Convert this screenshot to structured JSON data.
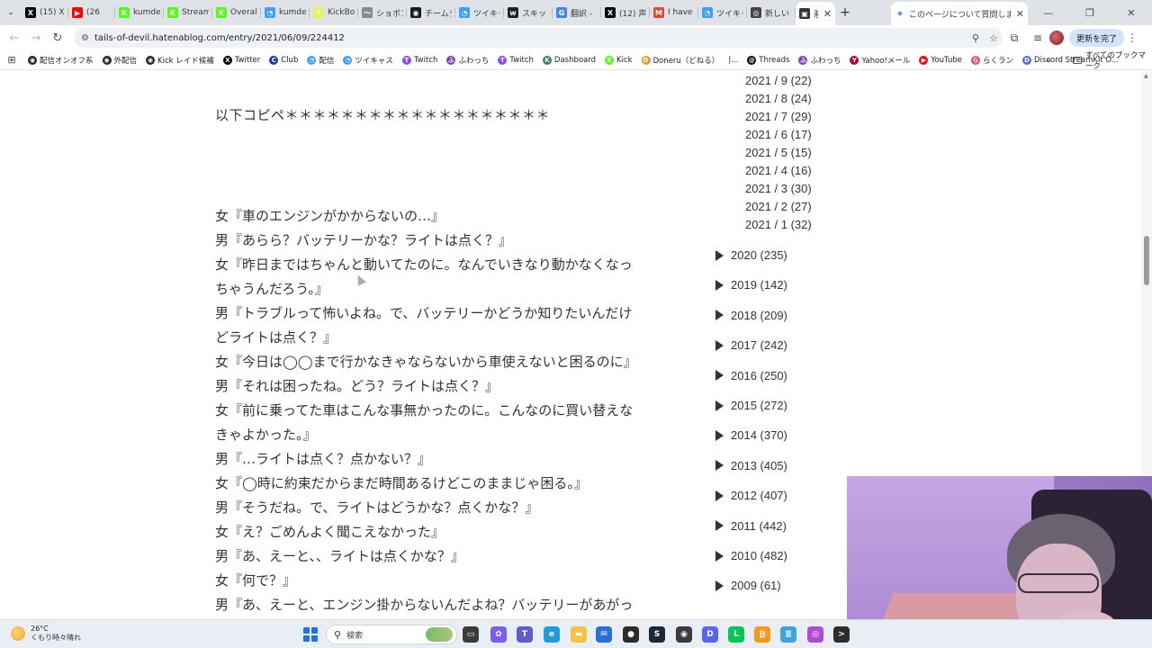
{
  "browser": {
    "tabs": [
      {
        "title": "(15) X",
        "color": "#000000",
        "glyph": "X"
      },
      {
        "title": "(26",
        "color": "#ff0000",
        "glyph": "▶"
      },
      {
        "title": "kumde",
        "color": "#53fc18",
        "glyph": "K"
      },
      {
        "title": "Stream",
        "color": "#53fc18",
        "glyph": "K"
      },
      {
        "title": "Overal",
        "color": "#53fc18",
        "glyph": "K"
      },
      {
        "title": "kumde",
        "color": "#3aa0ff",
        "glyph": "◔"
      },
      {
        "title": "KickBo",
        "color": "#e8f060",
        "glyph": "✕"
      },
      {
        "title": "ショボン",
        "color": "#8a8a8a",
        "glyph": "〜"
      },
      {
        "title": "チームデ",
        "color": "#1c1c1c",
        "glyph": "◉"
      },
      {
        "title": "ツイキャ",
        "color": "#3aa0ff",
        "glyph": "◔"
      },
      {
        "title": "スキッ",
        "color": "#222222",
        "glyph": "w"
      },
      {
        "title": "翻訳 -",
        "color": "#4285f4",
        "glyph": "G"
      },
      {
        "title": "(12) 声",
        "color": "#000000",
        "glyph": "X"
      },
      {
        "title": "I have",
        "color": "#ea4335",
        "glyph": "M"
      },
      {
        "title": "ツイキャ",
        "color": "#3aa0ff",
        "glyph": "◔"
      },
      {
        "title": "新しい",
        "color": "#444444",
        "glyph": "◎"
      },
      {
        "title": "悪",
        "color": "#333333",
        "glyph": "▣"
      }
    ],
    "gemini_tab": {
      "title": "このページについて質問しますか？",
      "glyph": "✦"
    },
    "new_tab_label": "+",
    "window_controls": {
      "minimize": "—",
      "restore": "❐",
      "close": "✕"
    },
    "nav": {
      "back": "←",
      "forward": "→",
      "reload": "↻",
      "site_info": "⚙"
    },
    "url": "tails-of-devil.hatenablog.com/entry/2021/06/09/224412",
    "omnibox_icons": {
      "zoom": "⚲",
      "bookmark": "☆"
    },
    "toolbar_icons": {
      "extensions": "⧉",
      "tab_search": "≡"
    },
    "update_button": "更新を完了",
    "menu": "⋮",
    "bookmarks": [
      {
        "label": "配信オンオフ系",
        "color": "#222222",
        "glyph": "◉"
      },
      {
        "label": "外配信",
        "color": "#222222",
        "glyph": "◉"
      },
      {
        "label": "Kick レイド候補",
        "color": "#222222",
        "glyph": "◉"
      },
      {
        "label": "Twitter",
        "color": "#000000",
        "glyph": "X"
      },
      {
        "label": "Club",
        "color": "#1a3ca8",
        "glyph": "C"
      },
      {
        "label": "配信",
        "color": "#3aa0ff",
        "glyph": "◔"
      },
      {
        "label": "ツイキャス",
        "color": "#3aa0ff",
        "glyph": "◔"
      },
      {
        "label": "Twitch",
        "color": "#9146ff",
        "glyph": "T"
      },
      {
        "label": "ふわっち",
        "color": "#7b3fbf",
        "glyph": "ふ"
      },
      {
        "label": "Twitch",
        "color": "#9146ff",
        "glyph": "T"
      },
      {
        "label": "Dashboard",
        "color": "#2a8a5a",
        "glyph": "K"
      },
      {
        "label": "Kick",
        "color": "#53fc18",
        "glyph": "K"
      },
      {
        "label": "Doneru（どねる）",
        "color": "#e39a2a",
        "glyph": "D"
      },
      {
        "label": "|...",
        "color": "#ffffff",
        "glyph": ""
      },
      {
        "label": "Threads",
        "color": "#000000",
        "glyph": "@"
      },
      {
        "label": "ふわっち",
        "color": "#7b3fbf",
        "glyph": "ふ"
      },
      {
        "label": "Yahoo!メール",
        "color": "#c0002a",
        "glyph": "Y"
      },
      {
        "label": "YouTube",
        "color": "#ff0000",
        "glyph": "▶"
      },
      {
        "label": "らくラン",
        "color": "#e04a8a",
        "glyph": "ら"
      },
      {
        "label": "Discord StreamKit O...",
        "color": "#5865f2",
        "glyph": "D"
      }
    ],
    "bookmarks_overflow": "»",
    "all_bookmarks": "すべてのブックマーク",
    "apps_icon": "⊞"
  },
  "article": {
    "heading": "以下コピペ＊＊＊＊＊＊＊＊＊＊＊＊＊＊＊＊＊＊＊",
    "lines": [
      "女『車のエンジンがかからないの…』",
      "男『あらら？バッテリーかな？ライトは点く？』",
      "女『昨日まではちゃんと動いてたのに。なんでいきなり動かなくなっ",
      "ちゃうんだろう。』",
      "男『トラブルって怖いよね。で、バッテリーかどうか知りたいんだけ",
      "どライトは点く？』",
      "女『今日は◯◯まで行かなきゃならないから車使えないと困るのに』",
      "男『それは困ったね。どう？ライトは点く？』",
      "女『前に乗ってた車はこんな事無かったのに。こんなのに買い替えな",
      "きゃよかった。』",
      "男『…ライトは点く？点かない？』",
      "女『◯時に約束だからまだ時間あるけどこのままじゃ困る。』",
      "男『そうだね。で、ライトはどうかな？点くかな？』",
      "女『え？ごめんよく聞こえなかった』",
      "男『あ、えーと、、ライトは点くかな？』",
      "女『何で？』",
      "男『あ、えーと、エンジン掛からないんだよね？バッテリーがあがっ"
    ]
  },
  "archive": {
    "months": [
      "2021 / 9 (22)",
      "2021 / 8 (24)",
      "2021 / 7 (29)",
      "2021 / 6 (17)",
      "2021 / 5 (15)",
      "2021 / 4 (16)",
      "2021 / 3 (30)",
      "2021 / 2 (27)",
      "2021 / 1 (32)"
    ],
    "years": [
      "2020 (235)",
      "2019 (142)",
      "2018 (209)",
      "2017 (242)",
      "2016 (250)",
      "2015 (272)",
      "2014 (370)",
      "2013 (405)",
      "2012 (407)",
      "2011 (442)",
      "2010 (482)",
      "2009 (61)"
    ]
  },
  "taskbar": {
    "weather_temp": "26°C",
    "weather_desc": "くもり時々晴れ",
    "search_label": "検索",
    "search_icon": "⚲",
    "apps": [
      {
        "name": "task-view",
        "color": "#3b3b3b",
        "glyph": "▭"
      },
      {
        "name": "copilot",
        "color": "#7a5cf0",
        "glyph": "✿"
      },
      {
        "name": "teams",
        "color": "#5b5fc7",
        "glyph": "T"
      },
      {
        "name": "edge",
        "color": "#1f9be0",
        "glyph": "e"
      },
      {
        "name": "explorer",
        "color": "#f5c242",
        "glyph": "▬"
      },
      {
        "name": "mail",
        "color": "#2a6fd6",
        "glyph": "✉"
      },
      {
        "name": "obs",
        "color": "#2b2b2b",
        "glyph": "●"
      },
      {
        "name": "steam",
        "color": "#1b2838",
        "glyph": "S"
      },
      {
        "name": "chrome",
        "color": "#3a3a3a",
        "glyph": "◉"
      },
      {
        "name": "discord",
        "color": "#5865f2",
        "glyph": "D"
      },
      {
        "name": "line",
        "color": "#06c755",
        "glyph": "L"
      },
      {
        "name": "app-orange",
        "color": "#f39a1e",
        "glyph": "₿"
      },
      {
        "name": "notepad",
        "color": "#3fa5d8",
        "glyph": "≣"
      },
      {
        "name": "app-purple",
        "color": "#b04bd8",
        "glyph": "◎"
      },
      {
        "name": "terminal",
        "color": "#2d2d2d",
        "glyph": ">"
      }
    ]
  }
}
